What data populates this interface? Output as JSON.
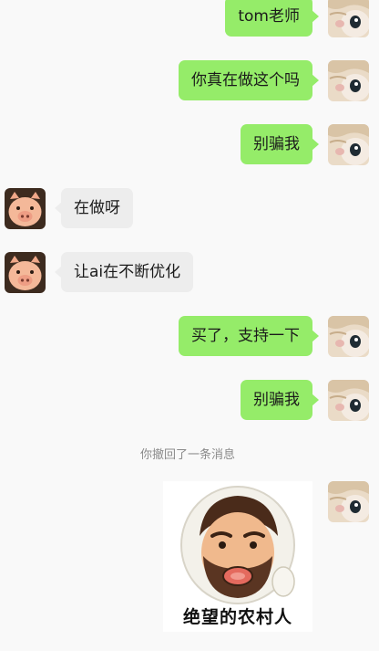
{
  "messages": [
    {
      "side": "me",
      "text": "tom老师"
    },
    {
      "side": "me",
      "text": "你真在做这个吗"
    },
    {
      "side": "me",
      "text": "别骗我"
    },
    {
      "side": "other",
      "text": "在做呀"
    },
    {
      "side": "other",
      "text": "让ai在不断优化"
    },
    {
      "side": "me",
      "text": "买了，支持一下"
    },
    {
      "side": "me",
      "text": "别骗我"
    }
  ],
  "recall_notice": "你撤回了一条消息",
  "sticker": {
    "caption": "绝望的农村人"
  },
  "colors": {
    "background": "#f9f9f9",
    "my_bubble": "#95ec69",
    "other_bubble": "#ededed",
    "notice_text": "#8a8a8a"
  },
  "icons": {
    "my_avatar": "cat-avatar-icon",
    "other_avatar": "pig-avatar-icon",
    "sticker_image": "bearded-man-sticker-icon"
  }
}
